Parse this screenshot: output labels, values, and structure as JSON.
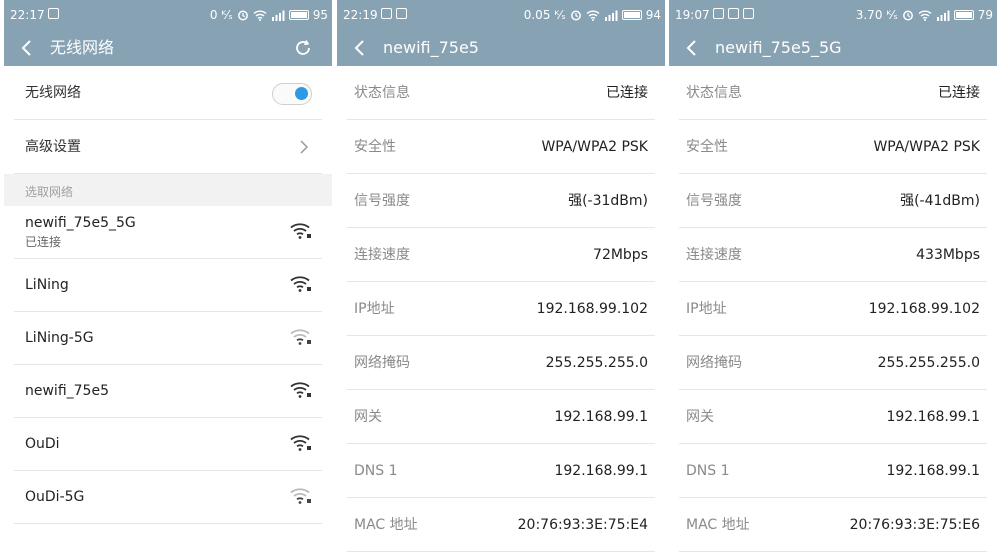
{
  "panels": [
    {
      "status": {
        "time": "22:17",
        "speed": "0 ᴷ⁄ₛ",
        "battery": "95"
      },
      "title": "无线网络",
      "wifi_toggle_label": "无线网络",
      "wifi_enabled": true,
      "advanced_label": "高级设置",
      "section_header": "选取网络",
      "networks": [
        {
          "name": "newifi_75e5_5G",
          "status": "已连接",
          "signal": "strong"
        },
        {
          "name": "LiNing",
          "status": "",
          "signal": "strong"
        },
        {
          "name": "LiNing-5G",
          "status": "",
          "signal": "weak"
        },
        {
          "name": "newifi_75e5",
          "status": "",
          "signal": "strong"
        },
        {
          "name": "OuDi",
          "status": "",
          "signal": "strong"
        },
        {
          "name": "OuDi-5G",
          "status": "",
          "signal": "weak"
        }
      ]
    },
    {
      "status": {
        "time": "22:19",
        "speed": "0.05 ᴷ⁄ₛ",
        "battery": "94"
      },
      "title": "newifi_75e5",
      "rows": [
        {
          "label": "状态信息",
          "value": "已连接"
        },
        {
          "label": "安全性",
          "value": "WPA/WPA2 PSK"
        },
        {
          "label": "信号强度",
          "value": "强(-31dBm)"
        },
        {
          "label": "连接速度",
          "value": "72Mbps"
        },
        {
          "label": "IP地址",
          "value": "192.168.99.102"
        },
        {
          "label": "网络掩码",
          "value": "255.255.255.0"
        },
        {
          "label": "网关",
          "value": "192.168.99.1"
        },
        {
          "label": "DNS 1",
          "value": "192.168.99.1"
        },
        {
          "label": "MAC 地址",
          "value": "20:76:93:3E:75:E4"
        }
      ]
    },
    {
      "status": {
        "time": "19:07",
        "speed": "3.70 ᴷ⁄ₛ",
        "battery": "79"
      },
      "title": "newifi_75e5_5G",
      "rows": [
        {
          "label": "状态信息",
          "value": "已连接"
        },
        {
          "label": "安全性",
          "value": "WPA/WPA2 PSK"
        },
        {
          "label": "信号强度",
          "value": "强(-41dBm)"
        },
        {
          "label": "连接速度",
          "value": "433Mbps"
        },
        {
          "label": "IP地址",
          "value": "192.168.99.102"
        },
        {
          "label": "网络掩码",
          "value": "255.255.255.0"
        },
        {
          "label": "网关",
          "value": "192.168.99.1"
        },
        {
          "label": "DNS 1",
          "value": "192.168.99.1"
        },
        {
          "label": "MAC 地址",
          "value": "20:76:93:3E:75:E6"
        }
      ]
    }
  ],
  "colors": {
    "header": "#86a2b3",
    "accent": "#2d9ae6"
  }
}
